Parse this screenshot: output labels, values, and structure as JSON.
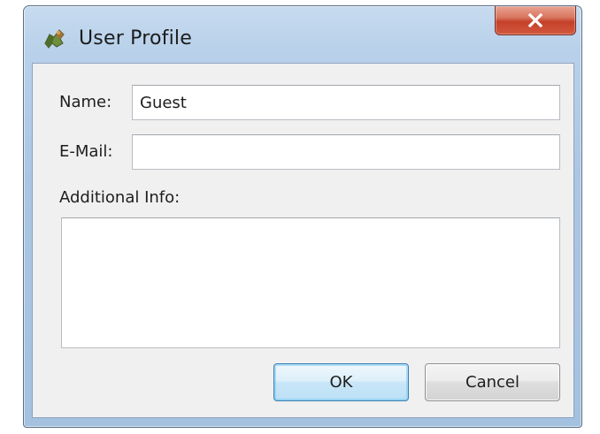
{
  "window": {
    "title": "User Profile",
    "app_icon": "puzzle-piece-icon",
    "close_icon": "close-icon"
  },
  "form": {
    "name_label": "Name:",
    "name_value": "Guest",
    "email_label": "E-Mail:",
    "email_value": "",
    "info_label": "Additional Info:",
    "info_value": ""
  },
  "buttons": {
    "ok_label": "OK",
    "cancel_label": "Cancel"
  },
  "colors": {
    "title_frame": "#abc6e3",
    "close_button": "#c4412a",
    "client_area": "#f0f0f0",
    "default_button_border": "#3c7fb1"
  }
}
